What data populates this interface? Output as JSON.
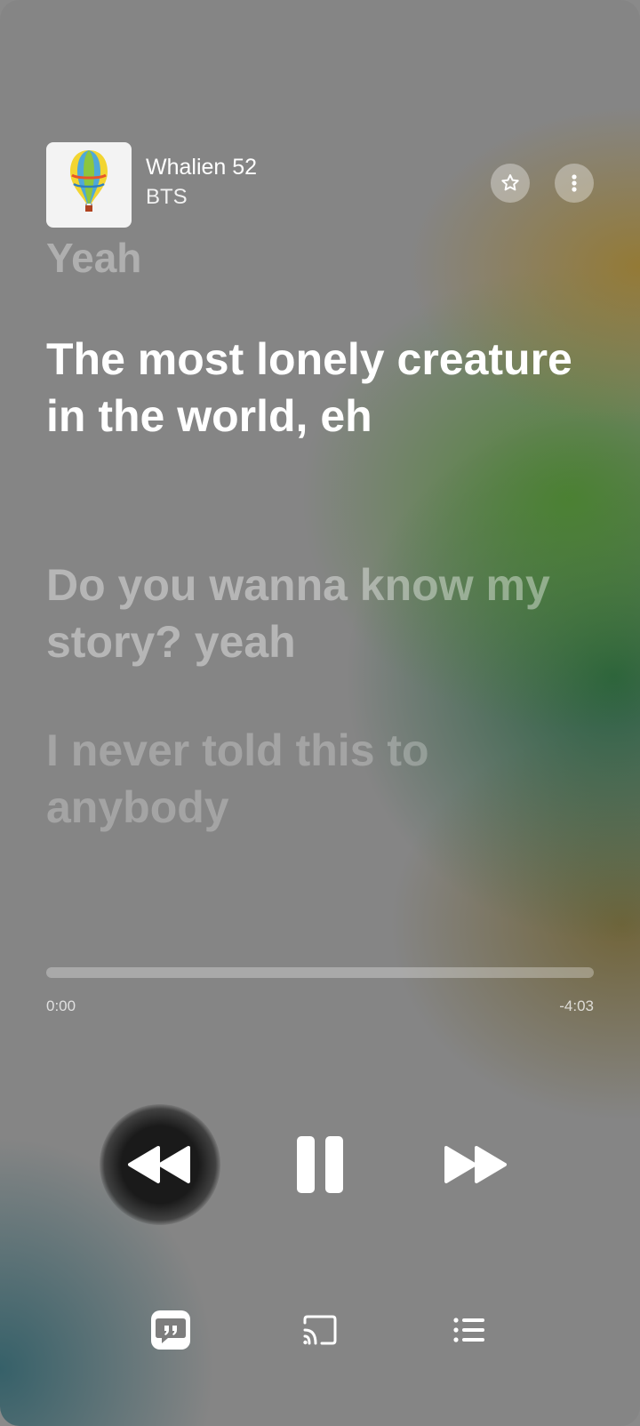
{
  "track": {
    "title": "Whalien 52",
    "artist": "BTS"
  },
  "lyrics": {
    "previous": "Yeah",
    "current": "The most lonely creature in the world, eh",
    "next": "Do you wanna know my story? yeah",
    "next2": "I never told this to anybody"
  },
  "playback": {
    "elapsed": "0:00",
    "remaining": "-4:03",
    "progress": 0.0
  },
  "icons": {
    "favorite": "star-icon",
    "more": "more-vertical-icon",
    "rewind": "rewind-icon",
    "pause": "pause-icon",
    "forward": "fast-forward-icon",
    "lyrics": "lyrics-quote-icon",
    "cast": "cast-icon",
    "queue": "queue-list-icon"
  }
}
